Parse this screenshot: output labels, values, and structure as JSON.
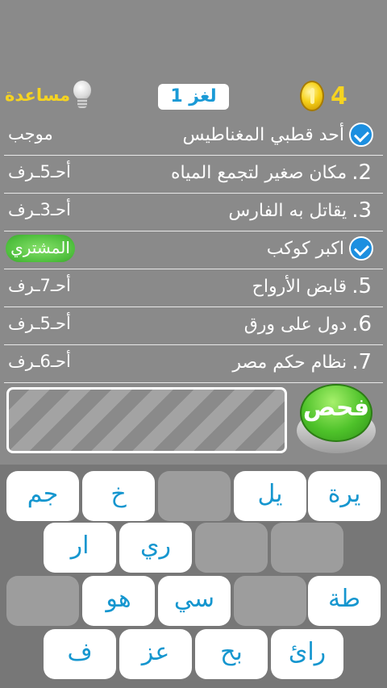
{
  "header": {
    "coins": "4",
    "puzzle_label": "لغز 1",
    "help_label": "مساعدة",
    "coin_icon": "coin-icon",
    "help_icon": "lightbulb-icon"
  },
  "clues": [
    {
      "num": "",
      "text": "أحد قطبي المغناطيس",
      "solved": true,
      "answer": "موجب"
    },
    {
      "num": "2.",
      "text": "مكان صغير لتجمع المياه",
      "solved": false,
      "answer": "أحـ5ـرف"
    },
    {
      "num": "3.",
      "text": "يقاتل به الفارس",
      "solved": false,
      "answer": "أحـ3ـرف"
    },
    {
      "num": "",
      "text": "اكبر كوكب",
      "solved": true,
      "answer": "المشتري"
    },
    {
      "num": "5.",
      "text": "قابض الأرواح",
      "solved": false,
      "answer": "أحـ7ـرف"
    },
    {
      "num": "6.",
      "text": "دول على ورق",
      "solved": false,
      "answer": "أحـ5ـرف"
    },
    {
      "num": "7.",
      "text": "نظام حكم مصر",
      "solved": false,
      "answer": "أحـ6ـرف"
    }
  ],
  "check_button": {
    "label": "فحص"
  },
  "keyboard": {
    "rows": [
      [
        "يرة",
        "يل",
        "",
        "خ",
        "جم"
      ],
      [
        "",
        "",
        "ري",
        "ار"
      ],
      [
        "طة",
        "",
        "سي",
        "هو",
        ""
      ],
      [
        "رائ",
        "بح",
        "عز",
        "ف"
      ]
    ]
  },
  "colors": {
    "background": "#8a8a8a",
    "gold": "#f5d321",
    "blue": "#1596cf",
    "green": "#4ec22a"
  }
}
